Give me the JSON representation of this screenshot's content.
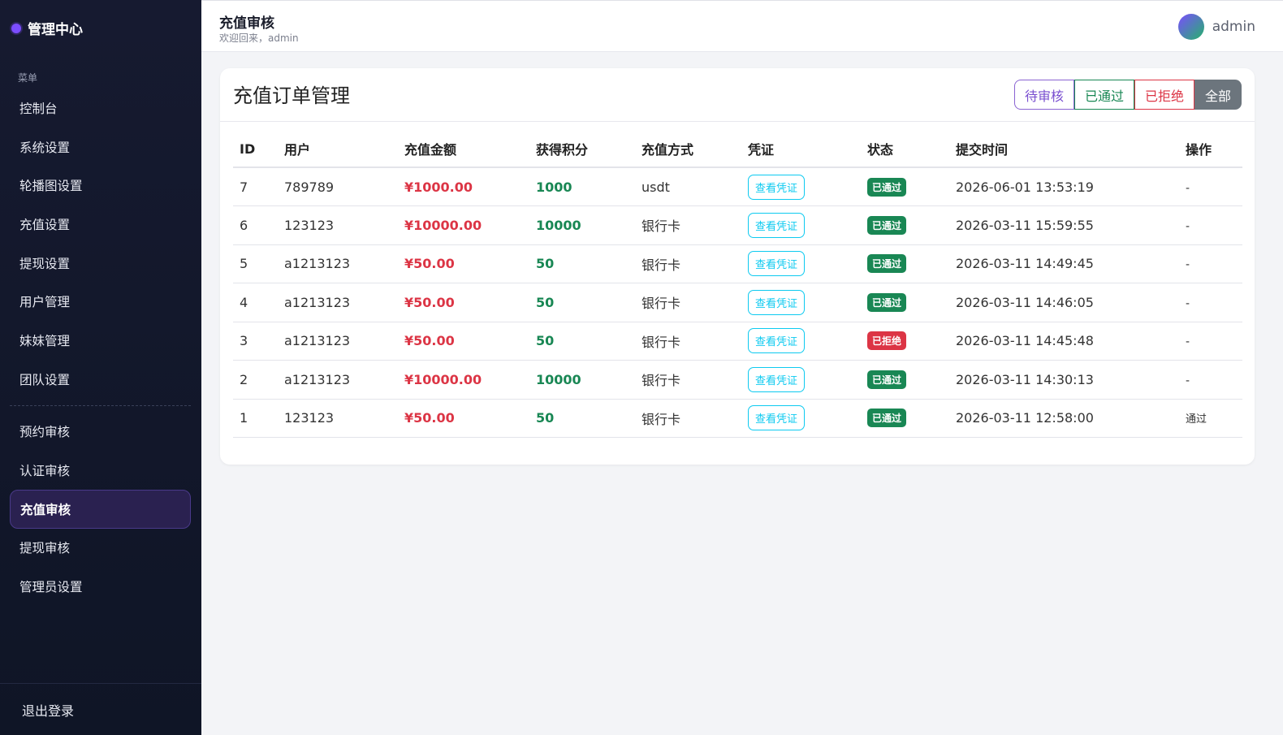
{
  "sidebar": {
    "brand": "管理中心",
    "caption": "菜单",
    "items_top": [
      {
        "label": "控制台",
        "name": "sidebar-item-dashboard"
      },
      {
        "label": "系统设置",
        "name": "sidebar-item-system-settings"
      },
      {
        "label": "轮播图设置",
        "name": "sidebar-item-carousel-settings"
      },
      {
        "label": "充值设置",
        "name": "sidebar-item-recharge-settings"
      },
      {
        "label": "提现设置",
        "name": "sidebar-item-withdraw-settings"
      },
      {
        "label": "用户管理",
        "name": "sidebar-item-user-management"
      },
      {
        "label": "妹妹管理",
        "name": "sidebar-item-meimei-management"
      },
      {
        "label": "团队设置",
        "name": "sidebar-item-team-settings"
      }
    ],
    "items_bottom": [
      {
        "label": "预约审核",
        "name": "sidebar-item-booking-review"
      },
      {
        "label": "认证审核",
        "name": "sidebar-item-verification-review"
      },
      {
        "label": "充值审核",
        "name": "sidebar-item-recharge-review"
      },
      {
        "label": "提现审核",
        "name": "sidebar-item-withdraw-review"
      },
      {
        "label": "管理员设置",
        "name": "sidebar-item-admin-settings"
      }
    ],
    "active": "充值审核",
    "logout": "退出登录"
  },
  "header": {
    "title": "充值审核",
    "welcome": "欢迎回来，admin",
    "username": "admin"
  },
  "card": {
    "title": "充值订单管理",
    "filters": [
      "待审核",
      "已通过",
      "已拒绝",
      "全部"
    ],
    "columns": [
      "ID",
      "用户",
      "充值金额",
      "获得积分",
      "充值方式",
      "凭证",
      "状态",
      "提交时间",
      "操作"
    ],
    "rows": [
      {
        "id": "7",
        "user": "789789",
        "amount": "¥1000.00",
        "points": "1000",
        "method": "usdt",
        "proof": "查看凭证",
        "status": "已通过",
        "status_type": "ok",
        "time": "2026-06-01 13:53:19",
        "op": "-"
      },
      {
        "id": "6",
        "user": "123123",
        "amount": "¥10000.00",
        "points": "10000",
        "method": "银行卡",
        "proof": "查看凭证",
        "status": "已通过",
        "status_type": "ok",
        "time": "2026-03-11 15:59:55",
        "op": "-"
      },
      {
        "id": "5",
        "user": "a1213123",
        "amount": "¥50.00",
        "points": "50",
        "method": "银行卡",
        "proof": "查看凭证",
        "status": "已通过",
        "status_type": "ok",
        "time": "2026-03-11 14:49:45",
        "op": "-"
      },
      {
        "id": "4",
        "user": "a1213123",
        "amount": "¥50.00",
        "points": "50",
        "method": "银行卡",
        "proof": "查看凭证",
        "status": "已通过",
        "status_type": "ok",
        "time": "2026-03-11 14:46:05",
        "op": "-"
      },
      {
        "id": "3",
        "user": "a1213123",
        "amount": "¥50.00",
        "points": "50",
        "method": "银行卡",
        "proof": "查看凭证",
        "status": "已拒绝",
        "status_type": "no",
        "time": "2026-03-11 14:45:48",
        "op": "-"
      },
      {
        "id": "2",
        "user": "a1213123",
        "amount": "¥10000.00",
        "points": "10000",
        "method": "银行卡",
        "proof": "查看凭证",
        "status": "已通过",
        "status_type": "ok",
        "time": "2026-03-11 14:30:13",
        "op": "-"
      },
      {
        "id": "1",
        "user": "123123",
        "amount": "¥50.00",
        "points": "50",
        "method": "银行卡",
        "proof": "查看凭证",
        "status": "已通过",
        "status_type": "ok",
        "time": "2026-03-11 12:58:00",
        "op": "通过"
      }
    ]
  },
  "colors": {
    "accent": "#7b4dff",
    "danger": "#dc3545",
    "success": "#198754",
    "info": "#0dcaf0",
    "secondary": "#6c757d"
  }
}
